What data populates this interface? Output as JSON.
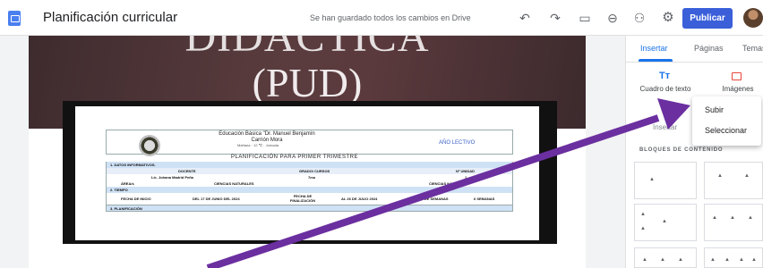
{
  "window": {
    "title": "Planificación curricular",
    "save_status": "Se han guardado todos los cambios en Drive",
    "publish_label": "Publicar"
  },
  "toolbar_icons": [
    "undo-icon",
    "redo-icon",
    "preview-icon",
    "link-icon",
    "add-person-icon",
    "settings-icon",
    "more-icon"
  ],
  "page": {
    "header_line1": "DIDÁCTICA",
    "header_line2": "(PUD)"
  },
  "embedded_doc": {
    "school": "Educación Básica \"Dr. Manuel Benjamín Carrión Mora",
    "school_sub": "Mañana · 12 ℃ · Jornada",
    "year_label": "AÑO LECTIVO",
    "plan_title": "PLANIFICACIÓN PARA PRIMER TRIMESTRE",
    "row1": "1. DATOS INFORMATIVOS.",
    "row2_cols": [
      "DOCENTE",
      "GRADO/ CURSOS",
      "Nº UNIDAD"
    ],
    "row3_cols": [
      "Lic. Johana Madrid Peña",
      "7mo",
      "1"
    ],
    "row4_cols": [
      "ÁREA/s",
      "CIENCIAS NATURALES",
      "CIENCIAS NATURALES"
    ],
    "row5": "2. TIEMPO",
    "row6_cols": [
      "FECHA DE INICIO",
      "DEL 17 DE JUNIO DEL 2024",
      "FECHA DE FINALIZACIÓN",
      "AL 26 DE JULIO 2024",
      "NÚMERO DE SEMANAS",
      "6 SEMANAS"
    ],
    "row7": "3. PLANIFICACIÓN"
  },
  "panel": {
    "tabs": [
      "Insertar",
      "Páginas",
      "Temas"
    ],
    "active_tab": "Insertar",
    "tools": [
      "Cuadro de texto",
      "Imágenes"
    ],
    "insert_label": "Insertar",
    "section_label": "BLOQUES DE CONTENIDO"
  },
  "dropdown": {
    "items": [
      "Subir",
      "Seleccionar"
    ]
  },
  "colors": {
    "accent": "#1a73e8",
    "publish": "#3a5fd9",
    "arrow": "#6b2fa0"
  }
}
